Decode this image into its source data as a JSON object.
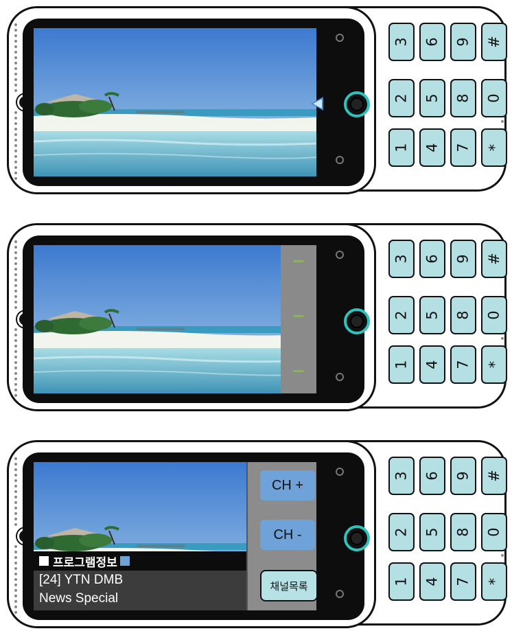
{
  "keypad": {
    "rows": [
      [
        "3",
        "6",
        "9",
        "#"
      ],
      [
        "2",
        "5",
        "8",
        "0"
      ],
      [
        "1",
        "4",
        "7",
        "*"
      ]
    ]
  },
  "screen3": {
    "ch_plus_label": "CH +",
    "ch_minus_label": "CH -",
    "channel_list_label": "채널목록",
    "program_info_header": "프로그램정보",
    "channel_line": "[24] YTN DMB",
    "program_line": "News Special"
  },
  "colors": {
    "keypad_fill": "#b4dfe3",
    "nav_ring": "#2fc2bd",
    "ch_button": "#6fa2d9",
    "volume_tick": "#7fbf3a"
  },
  "icons": [
    "side-button-icon",
    "soft-key-icon",
    "nav-button-icon",
    "pointer-arrow-icon"
  ]
}
